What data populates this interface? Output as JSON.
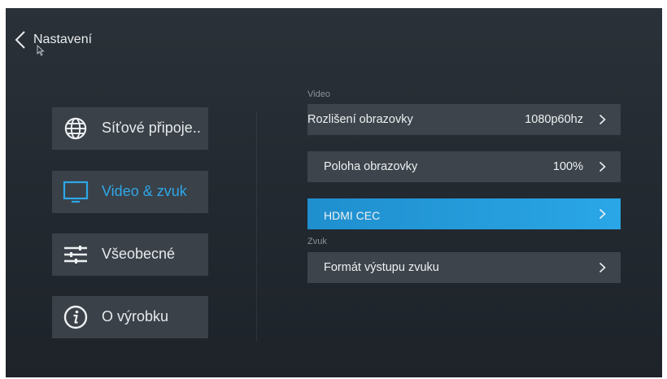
{
  "header": {
    "title": "Nastavení"
  },
  "menu": {
    "items": [
      {
        "label": "Síťové připoje..",
        "icon": "globe-icon"
      },
      {
        "label": "Video & zvuk",
        "icon": "monitor-icon"
      },
      {
        "label": "Všeobecné",
        "icon": "sliders-icon"
      },
      {
        "label": "O výrobku",
        "icon": "info-icon"
      }
    ],
    "active_index": 1
  },
  "content": {
    "video_section_label": "Video",
    "rows": [
      {
        "label": "Rozlišení obrazovky",
        "value": "1080p60hz"
      },
      {
        "label": "Poloha obrazovky",
        "value": "100%"
      },
      {
        "label": "HDMI CEC",
        "value": ""
      }
    ],
    "audio_section_label": "Zvuk",
    "audio_rows": [
      {
        "label": "Formát výstupu zvuku",
        "value": ""
      }
    ]
  },
  "colors": {
    "accent": "#2ea7e8",
    "focus_row": "#1f8fce",
    "tile_bg": "#3a4148",
    "row_bg": "#3d444b"
  }
}
